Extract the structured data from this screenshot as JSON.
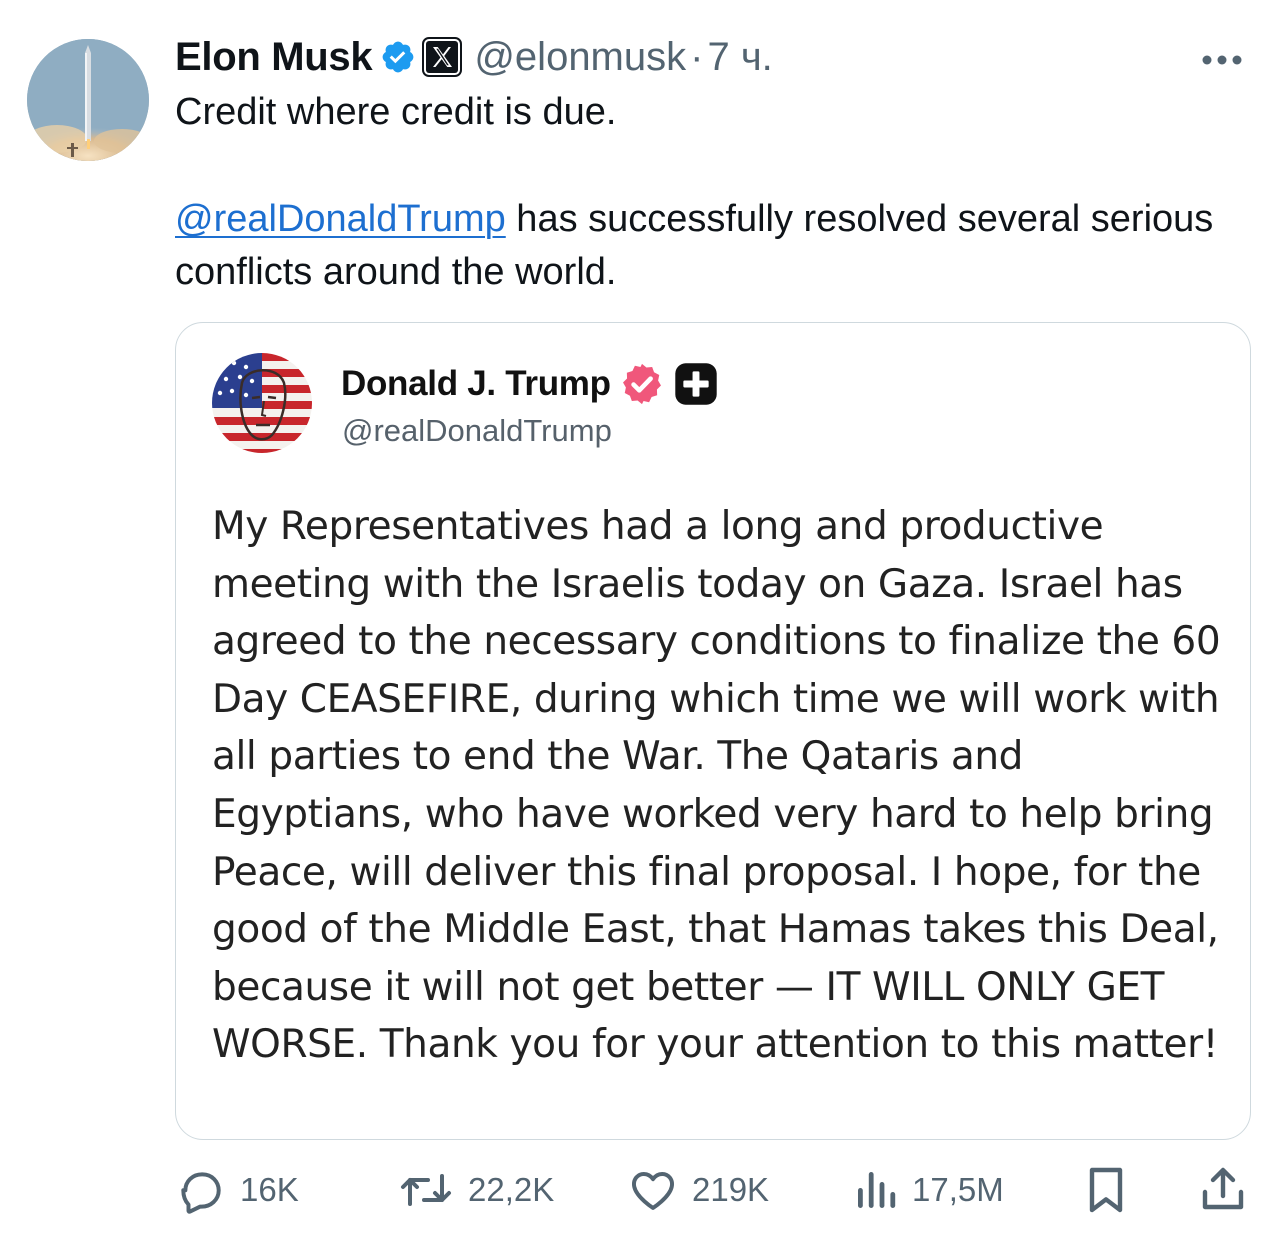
{
  "tweet": {
    "author_name": "Elon Musk",
    "handle": "@elonmusk",
    "separator": "·",
    "time": "7 ч.",
    "line1": "Credit where credit is due.",
    "mention": "@realDonaldTrump",
    "line2_rest": " has successfully resolved several serious conflicts around the world."
  },
  "quote": {
    "author_name": "Donald J. Trump",
    "handle": "@realDonaldTrump",
    "body": "My Representatives had a long and productive meeting with the Israelis today on Gaza. Israel has agreed to the necessary conditions to finalize the 60 Day CEASEFIRE, during which time we will work with all parties to end the War. The Qataris and Egyptians, who have worked very hard to help bring Peace, will deliver this final proposal. I hope, for the good of the Middle East, that Hamas takes this Deal, because it will not get better — IT WILL ONLY GET WORSE. Thank you for your attention to this matter!"
  },
  "actions": {
    "replies": "16K",
    "reposts": "22,2K",
    "likes": "219K",
    "views": "17,5M"
  },
  "colors": {
    "verified_blue": "#1d9bf0",
    "verified_pink": "#f0577b",
    "link_blue": "#1d6fd0",
    "muted_gray": "#536471"
  },
  "icons": {
    "verified": "verified-badge-icon",
    "x_badge": "x-logo-icon",
    "more": "more-dots-icon",
    "reply": "reply-bubble-icon",
    "repost": "repost-arrows-icon",
    "like": "heart-icon",
    "views": "views-bars-icon",
    "bookmark": "bookmark-icon",
    "share": "share-upload-icon"
  }
}
